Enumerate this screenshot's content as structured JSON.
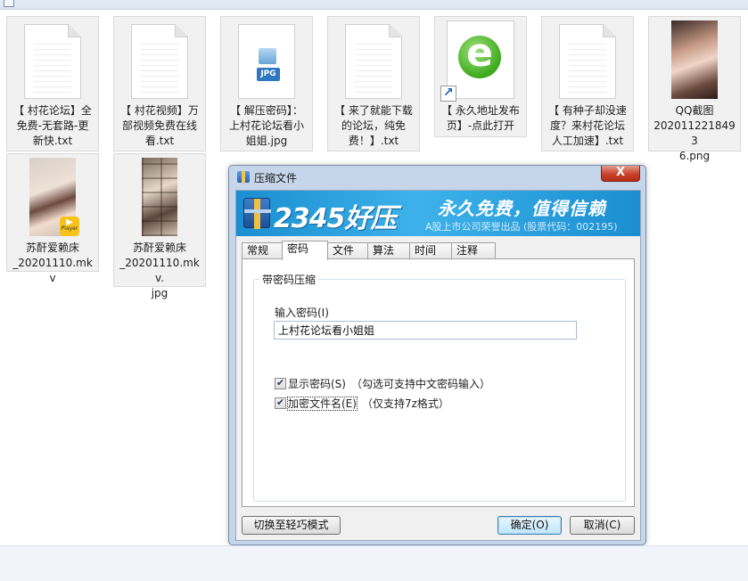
{
  "window_fragment": {
    "label": ""
  },
  "files": [
    {
      "id": "f1",
      "lines": [
        "【 村花论坛】全",
        "免费-无套路-更",
        "新快.txt"
      ],
      "kind": "txt"
    },
    {
      "id": "f2",
      "lines": [
        "【 村花视频】万",
        "部视频免费在线",
        "看.txt"
      ],
      "kind": "txt"
    },
    {
      "id": "f3",
      "lines": [
        "【 解压密码】：",
        "上村花论坛看小",
        "姐姐.jpg"
      ],
      "kind": "jpg",
      "badge": "JPG"
    },
    {
      "id": "f4",
      "lines": [
        "【 来了就能下载",
        "的论坛，纯免",
        "费！】.txt"
      ],
      "kind": "txt"
    },
    {
      "id": "f5",
      "lines": [
        "【 永久地址发布",
        "页】-点此打开"
      ],
      "kind": "shortcut"
    },
    {
      "id": "f6",
      "lines": [
        "【 有种子却没速",
        "度？来村花论坛",
        "人工加速】.txt"
      ],
      "kind": "txt"
    },
    {
      "id": "f7",
      "lines": [
        "QQ截图",
        "2020112218493",
        "6.png"
      ],
      "kind": "png"
    },
    {
      "id": "f8",
      "lines": [
        "苏酐爱赖床",
        "_20201110.mkv"
      ],
      "kind": "mkv",
      "badge": "Player"
    },
    {
      "id": "f9",
      "lines": [
        "苏酐爱赖床",
        "_20201110.mkv.",
        "jpg"
      ],
      "kind": "jpg-collage"
    }
  ],
  "dialog": {
    "title": "压缩文件",
    "close_label": "X",
    "banner": {
      "brand": "2345好压",
      "slogan": "永久免费，值得信赖",
      "subline": "A股上市公司荣誉出品 (股票代码：002195)"
    },
    "tabs": [
      "常规",
      "密码",
      "文件",
      "算法",
      "时间",
      "注释"
    ],
    "active_tab": "密码",
    "group_title": "带密码压缩",
    "password_label": "输入密码(I)",
    "password_value": "上村花论坛看小姐姐",
    "show_password": {
      "label": "显示密码(S)",
      "hint": "（勾选可支持中文密码输入）",
      "checked": true
    },
    "encrypt_names": {
      "label": "加密文件名(E)",
      "hint": "（仅支持7z格式）",
      "checked": true
    },
    "buttons": {
      "switch_mode": "切换至轻巧模式",
      "ok": "确定(O)",
      "cancel": "取消(C)"
    }
  },
  "colors": {
    "banner": "#1a8ed0",
    "dialog_frame": "#c5d6ea",
    "close_button": "#c8422b"
  }
}
